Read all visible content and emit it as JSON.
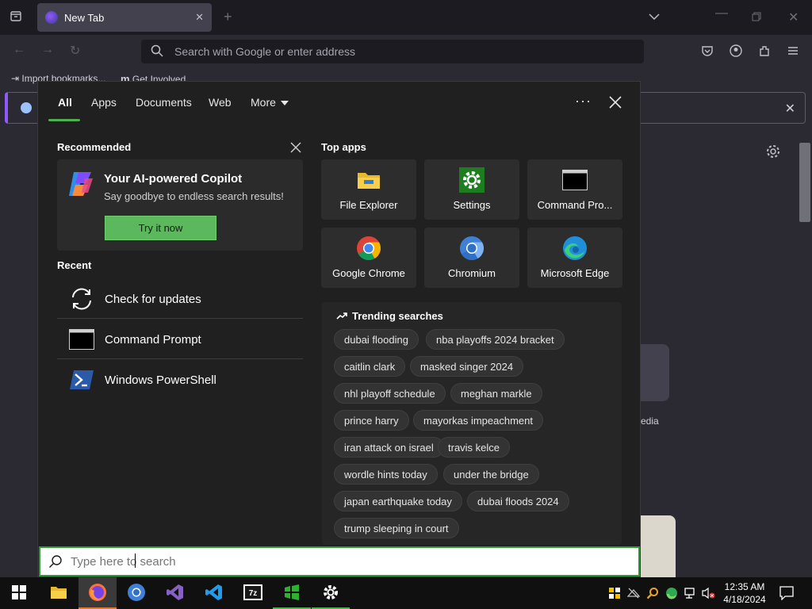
{
  "firefox": {
    "tab_title": "New Tab",
    "url_placeholder": "Search with Google or enter address",
    "bookmarks": [
      "Import bookmarks...",
      "Get Involved"
    ],
    "partial_label": "edia"
  },
  "search_panel": {
    "tabs": [
      "All",
      "Apps",
      "Documents",
      "Web",
      "More"
    ],
    "recommended_title": "Recommended",
    "copilot": {
      "title": "Your AI-powered Copilot",
      "subtitle": "Say goodbye to endless search results!",
      "button": "Try it now"
    },
    "recent_title": "Recent",
    "recent_items": [
      "Check for updates",
      "Command Prompt",
      "Windows PowerShell"
    ],
    "top_apps_title": "Top apps",
    "top_apps": [
      "File Explorer",
      "Settings",
      "Command Pro...",
      "Google Chrome",
      "Chromium",
      "Microsoft Edge"
    ],
    "trending_title": "Trending searches",
    "trending": [
      "dubai flooding",
      "nba playoffs 2024 bracket",
      "caitlin clark",
      "masked singer 2024",
      "nhl playoff schedule",
      "meghan markle",
      "prince harry",
      "mayorkas impeachment",
      "iran attack on israel",
      "travis kelce",
      "wordle hints today",
      "under the bridge",
      "japan earthquake today",
      "dubai floods 2024",
      "trump sleeping in court"
    ]
  },
  "searchbox": {
    "placeholder": "Type here to search"
  },
  "taskbar": {
    "time": "12:35 AM",
    "date": "4/18/2024"
  },
  "colors": {
    "accent_green": "#4caf50",
    "panel_bg": "#202020",
    "taskbar_bg": "#101010"
  }
}
